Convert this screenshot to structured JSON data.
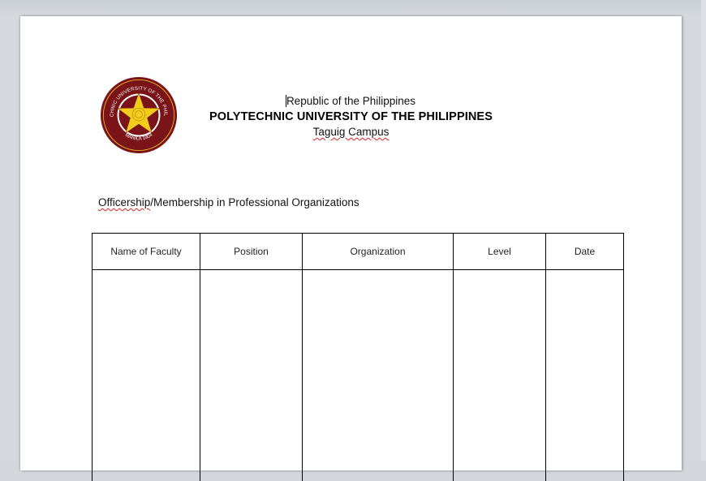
{
  "header": {
    "line1": "Republic of the Philippines",
    "university": "POLYTECHNIC UNIVERSITY OF THE PHILIPPINES",
    "campus": "Taguig Campus"
  },
  "logo": {
    "seal_text_top": "POLYTECHNIC UNIVERSITY OF THE PHILIPPINES",
    "seal_text_bottom": "MANILA 1904",
    "colors": {
      "maroon": "#7a1418",
      "gold": "#f2cc1b",
      "white": "#ffffff"
    }
  },
  "section": {
    "title_part1": "Officership",
    "title_part2": "/Membership in Professional Organizations"
  },
  "table": {
    "columns": [
      "Name of Faculty",
      "Position",
      "Organization",
      "Level",
      "Date"
    ],
    "rows": []
  }
}
